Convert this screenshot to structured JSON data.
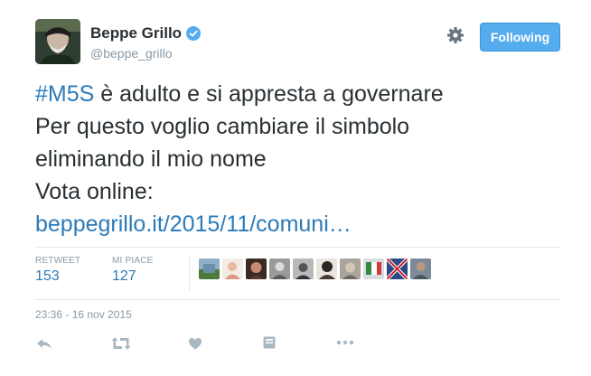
{
  "author": {
    "display_name": "Beppe Grillo",
    "handle": "@beppe_grillo",
    "verified": true
  },
  "header": {
    "follow_label": "Following"
  },
  "tweet": {
    "hashtag": "#M5S",
    "line1_rest": " è adulto e si appresta a governare",
    "line2": "Per questo voglio cambiare il simbolo",
    "line3": "eliminando il mio nome",
    "line4": "Vota online:",
    "link": "beppegrillo.it/2015/11/comuni…"
  },
  "stats": {
    "retweet_label": "RETWEET",
    "retweet_count": "153",
    "like_label": "MI PIACE",
    "like_count": "127"
  },
  "likers_count_shown": 10,
  "timestamp": "23:36 - 16 nov 2015",
  "actions": [
    "reply-icon",
    "retweet-icon",
    "like-icon",
    "card-icon",
    "more-icon"
  ],
  "colors": {
    "link": "#2b7bb9",
    "follow_button": "#55acee",
    "muted": "#8899a6",
    "verified": "#55acee"
  }
}
